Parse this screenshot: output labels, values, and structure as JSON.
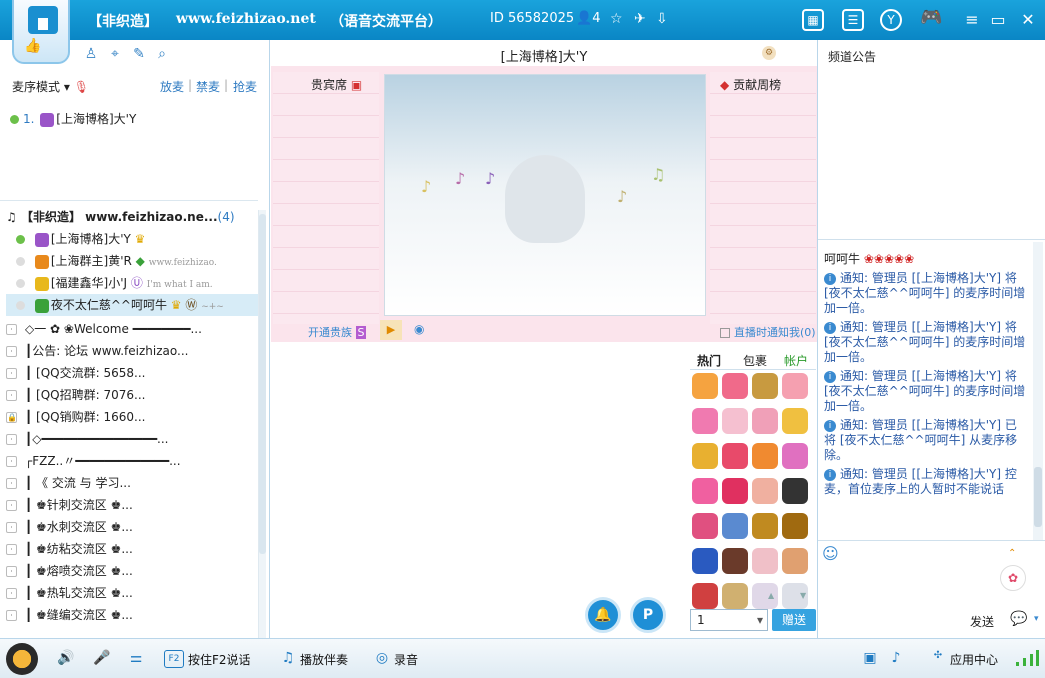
{
  "titlebar": {
    "app_name": "【非织造】",
    "site": "www.feizhizao.net",
    "subtitle": "（语音交流平台）",
    "id_label": "ID 56582025",
    "user_count": "4"
  },
  "left": {
    "mic_mode_label": "麦序模式",
    "mic_actions": [
      "放麦",
      "禁麦",
      "抢麦"
    ],
    "queue": [
      {
        "index": "1.",
        "name": "[上海博格]大'Y"
      }
    ],
    "channel_root": {
      "name": "【非织造】 www.feizhizao.ne...",
      "count": "(4)"
    },
    "users": [
      {
        "name": "[上海博格]大'Y",
        "extra": ""
      },
      {
        "name": "[上海群主]黄'R",
        "extra": "www.feizhizao."
      },
      {
        "name": "[福建鑫华]小'J",
        "extra": "I'm what I am."
      },
      {
        "name": "夜不太仁慈^^呵呵牛",
        "extra": "~+~"
      }
    ],
    "channels": [
      "◇一 ✿ ❀Welcome ━━━━━━━━...",
      "┃公告:   论坛   www.feizhizao...",
      "┃       [QQ交流群: 5658...",
      "┃       [QQ招聘群: 7076...",
      "┃       [QQ销购群: 1660...",
      "┃◇━━━━━━━━━━━━━━━━...",
      "┌FZZ..〃━━━━━━━━━━━━━...",
      "┃         《 交流 与 学习...",
      "┃              ♚针刺交流区 ♚...",
      "┃              ♚水刺交流区 ♚...",
      "┃              ♚纺粘交流区 ♚...",
      "┃              ♚熔喷交流区 ♚...",
      "┃              ♚热轧交流区 ♚...",
      "┃              ♚缝编交流区 ♚..."
    ]
  },
  "center": {
    "room_title": "[上海博格]大'Y",
    "vip_label": "贵宾席",
    "rank_label": "贡献周榜",
    "open_noble": "开通贵族",
    "notify_label": "直播时通知我(0)",
    "gift_tabs": [
      "热门",
      "包裹",
      "帐户"
    ],
    "qty_value": "1",
    "send_gift": "赠送"
  },
  "right": {
    "announcement_title": "频道公告",
    "chat_top": "呵呵牛",
    "messages": [
      "通知: 管理员 [[上海博格]大'Y] 将 [夜不太仁慈^^呵呵牛] 的麦序时间增加一倍。",
      "通知: 管理员 [[上海博格]大'Y] 将 [夜不太仁慈^^呵呵牛] 的麦序时间增加一倍。",
      "通知: 管理员 [[上海博格]大'Y] 将 [夜不太仁慈^^呵呵牛] 的麦序时间增加一倍。",
      "通知: 管理员 [[上海博格]大'Y] 已将 [夜不太仁慈^^呵呵牛] 从麦序移除。",
      "通知: 管理员 [[上海博格]大'Y] 控麦，首位麦序上的人暂时不能说话"
    ],
    "send_label": "发送"
  },
  "bottom": {
    "ptt_label": "按住F2说话",
    "play_label": "播放伴奏",
    "record_label": "录音",
    "app_label": "应用中心"
  }
}
